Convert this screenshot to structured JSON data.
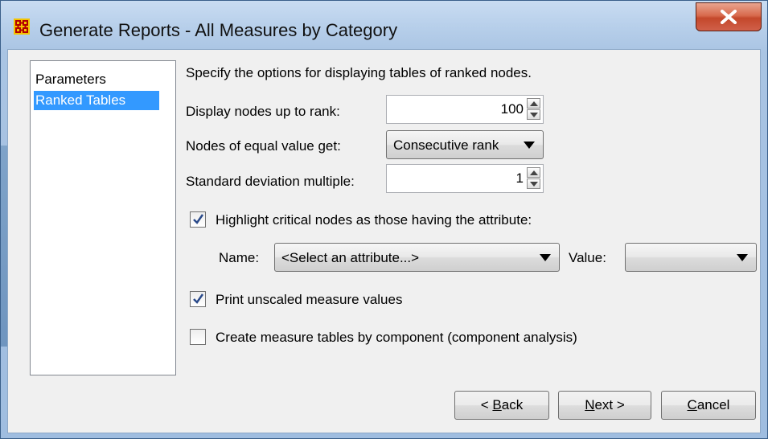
{
  "window": {
    "title": "Generate Reports - All Measures by Category",
    "app_icon": "ora-network-icon",
    "close_icon": "close-x-icon"
  },
  "nav": {
    "items": [
      {
        "label": "Parameters",
        "selected": false
      },
      {
        "label": "Ranked Tables",
        "selected": true
      }
    ]
  },
  "main": {
    "description": "Specify the options for displaying tables of ranked nodes.",
    "display_rank": {
      "label": "Display nodes up to rank:",
      "value": "100"
    },
    "equal_value": {
      "label": "Nodes of equal value get:",
      "value": "Consecutive rank"
    },
    "std_dev": {
      "label": "Standard deviation multiple:",
      "value": "1"
    },
    "highlight": {
      "label": "Highlight critical nodes as those having the attribute:",
      "checked": true
    },
    "name_label": "Name:",
    "name_value": "<Select an attribute...>",
    "value_label": "Value:",
    "value_value": "",
    "print_unscaled": {
      "label": "Print unscaled measure values",
      "checked": true
    },
    "by_component": {
      "label": "Create measure tables by component (component analysis)",
      "checked": false
    }
  },
  "buttons": {
    "back_prefix": "< ",
    "back_mnemonic": "B",
    "back_rest": "ack",
    "next_mnemonic": "N",
    "next_rest": "ext >",
    "cancel_mnemonic": "C",
    "cancel_rest": "ancel"
  },
  "colors": {
    "selection": "#3399ff",
    "close_button": "#c4482b",
    "dialog_bg": "#f0f0f0"
  }
}
